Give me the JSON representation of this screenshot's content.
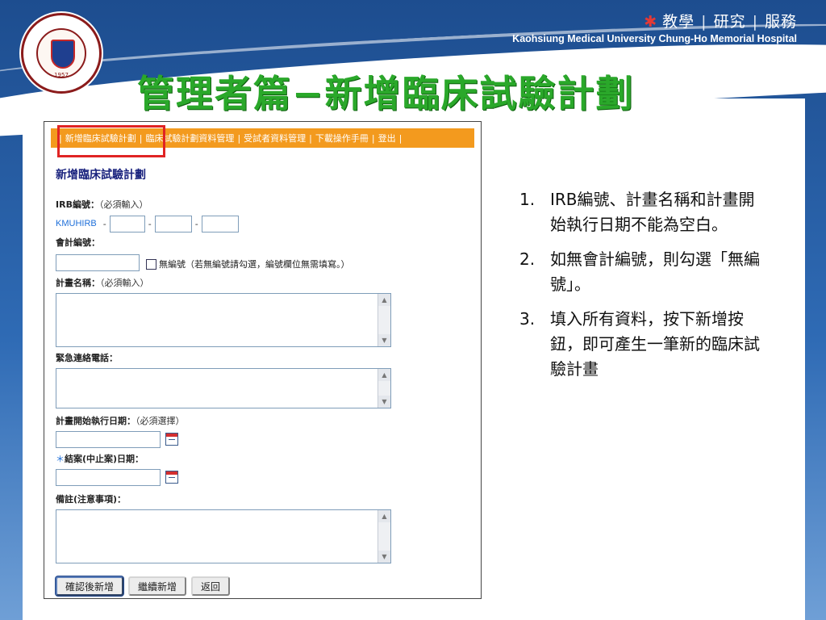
{
  "header": {
    "slogan": [
      "教學",
      "研究",
      "服務"
    ],
    "hospital_name": "Kaohsiung Medical University  Chung-Ho Memorial Hospital",
    "slide_title": "管理者篇−新增臨床試驗計劃",
    "logo_year": "1957"
  },
  "nav": {
    "items": [
      "新增臨床試驗計劃",
      "臨床試驗計劃資料管理",
      "受試者資料管理",
      "下載操作手冊",
      "登出"
    ]
  },
  "form": {
    "heading": "新增臨床試驗計劃",
    "irb_label": "IRB編號：",
    "irb_note": "（必須輸入）",
    "irb_prefix": "KMUHIRB",
    "irb_dash": "-",
    "account_label": "會計編號：",
    "no_number_label": "無編號（若無編號請勾選，編號欄位無需填寫。）",
    "plan_name_label": "計畫名稱：",
    "plan_name_note": "（必須輸入）",
    "emergency_label": "緊急連絡電話：",
    "start_date_label": "計畫開始執行日期：",
    "start_date_note": "（必須選擇）",
    "end_date_label": "結案(中止案)日期：",
    "end_date_star": "＊",
    "remarks_label": "備註(注意事項)：",
    "buttons": [
      "確認後新增",
      "繼續新增",
      "返回"
    ]
  },
  "notes": [
    {
      "num": "1.",
      "text": "IRB編號、計畫名稱和計畫開始執行日期不能為空白。"
    },
    {
      "num": "2.",
      "text": "如無會計編號，則勾選「無編號」。"
    },
    {
      "num": "3.",
      "text": "填入所有資料，按下新增按鈕，即可產生一筆新的臨床試驗計畫"
    }
  ],
  "colors": {
    "nav_bar": "#f39a1e",
    "title_green": "#2aa82a",
    "highlight_red": "#e02424",
    "background_blue": "#2f6bb5"
  }
}
